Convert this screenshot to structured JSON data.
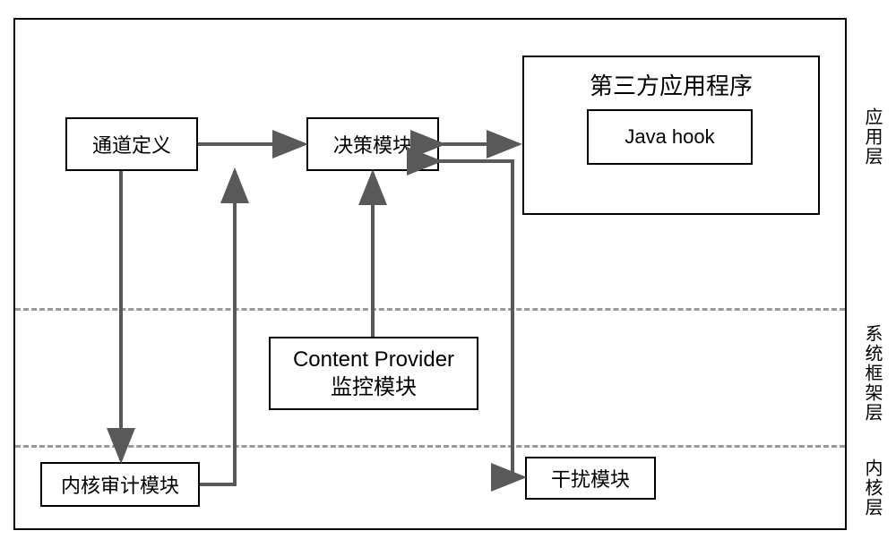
{
  "chart_data": {
    "type": "diagram",
    "title": "",
    "layers": [
      {
        "id": "app_layer",
        "label": "应用层"
      },
      {
        "id": "framework_layer",
        "label": "系统框架层"
      },
      {
        "id": "kernel_layer",
        "label": "内核层"
      }
    ],
    "nodes": [
      {
        "id": "channel_def",
        "label": "通道定义",
        "layer": "app_layer"
      },
      {
        "id": "decision",
        "label": "决策模块",
        "layer": "app_layer"
      },
      {
        "id": "third_party",
        "label": "第三方应用程序",
        "layer": "app_layer"
      },
      {
        "id": "java_hook",
        "label": "Java hook",
        "layer": "app_layer",
        "parent": "third_party"
      },
      {
        "id": "cp_monitor",
        "label_line1": "Content Provider",
        "label_line2": "监控模块",
        "layer": "framework_layer"
      },
      {
        "id": "kernel_audit",
        "label": "内核审计模块",
        "layer": "kernel_layer"
      },
      {
        "id": "interference",
        "label": "干扰模块",
        "layer": "kernel_layer"
      }
    ],
    "edges": [
      {
        "from": "channel_def",
        "to": "decision",
        "bidirectional": false
      },
      {
        "from": "channel_def",
        "to": "kernel_audit",
        "bidirectional": false
      },
      {
        "from": "kernel_audit",
        "to": "decision",
        "bidirectional": false
      },
      {
        "from": "cp_monitor",
        "to": "decision",
        "bidirectional": false
      },
      {
        "from": "decision",
        "to": "third_party",
        "bidirectional": true
      },
      {
        "from": "decision",
        "to": "interference",
        "bidirectional": false
      }
    ]
  },
  "boxes": {
    "channel_def": "通道定义",
    "decision": "决策模块",
    "third_party": "第三方应用程序",
    "java_hook": "Java hook",
    "cp_line1": "Content Provider",
    "cp_line2": "监控模块",
    "kernel_audit": "内核审计模块",
    "interference": "干扰模块"
  },
  "layers": {
    "app": "应用层",
    "framework": "系统框架层",
    "kernel": "内核层"
  }
}
